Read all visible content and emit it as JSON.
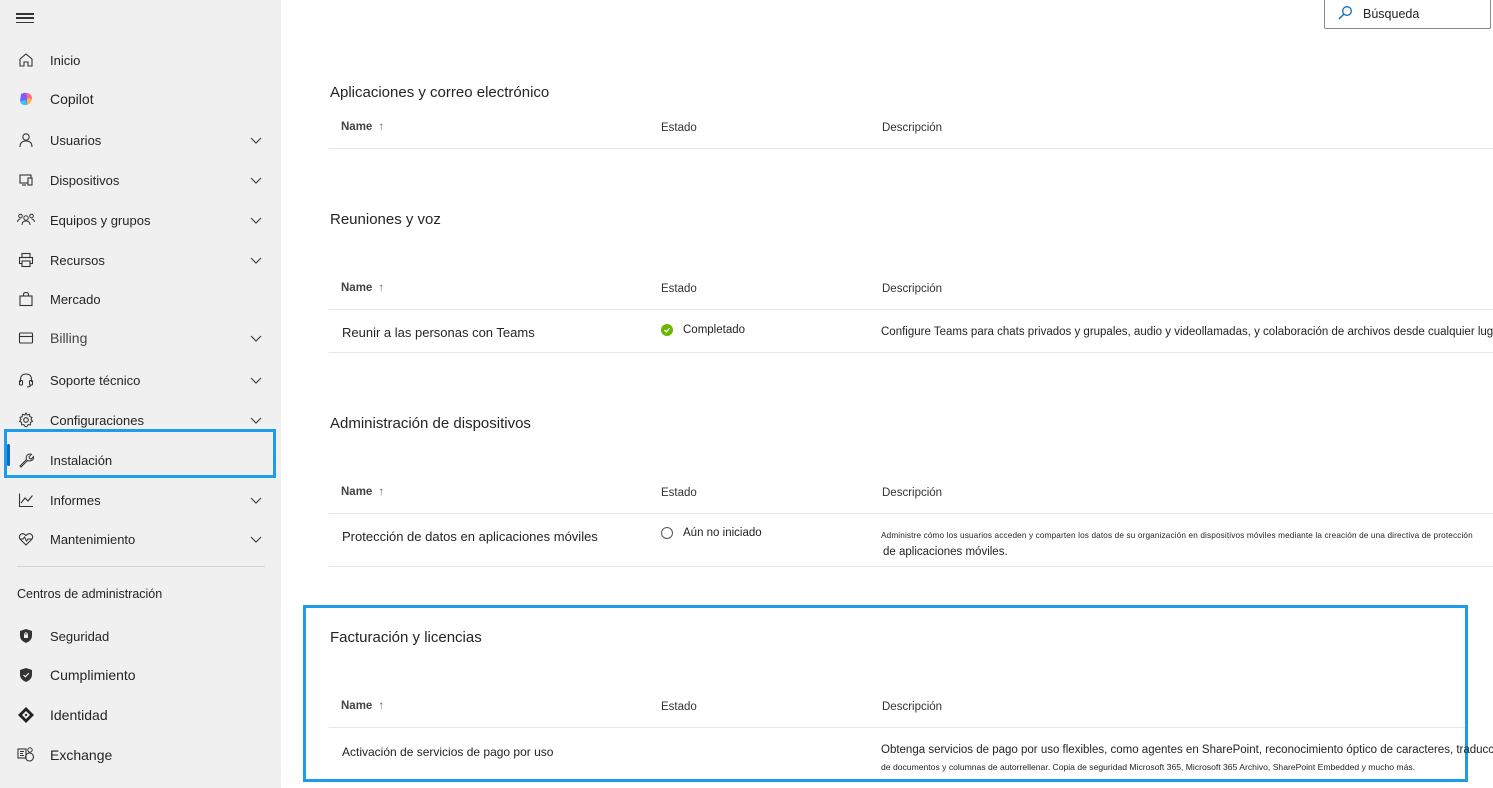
{
  "search": {
    "placeholder": "Búsqueda"
  },
  "sidebar": {
    "items": [
      {
        "label": "Inicio",
        "icon": "home-icon"
      },
      {
        "label": "Copilot",
        "icon": "copilot-icon"
      },
      {
        "label": "Usuarios",
        "icon": "person-icon"
      },
      {
        "label": "Dispositivos",
        "icon": "device-icon"
      },
      {
        "label": "Equipos y grupos",
        "icon": "people-team-icon"
      },
      {
        "label": "Recursos",
        "icon": "printer-icon"
      },
      {
        "label": "Mercado",
        "icon": "shopping-bag-icon"
      },
      {
        "label": "Billing",
        "icon": "credit-card-icon"
      },
      {
        "label": "Soporte técnico",
        "icon": "headset-icon"
      },
      {
        "label": "Configuraciones",
        "icon": "gear-icon"
      },
      {
        "label": "Instalación",
        "icon": "wrench-icon"
      },
      {
        "label": "Informes",
        "icon": "chart-line-icon"
      },
      {
        "label": "Mantenimiento",
        "icon": "heart-pulse-icon"
      }
    ],
    "admin_centers_title": "Centros de administración",
    "admin_centers": [
      {
        "label": "Seguridad",
        "icon": "shield-icon"
      },
      {
        "label": "Cumplimiento",
        "icon": "shield-compliance-icon"
      },
      {
        "label": "Identidad",
        "icon": "identity-diamond-icon"
      },
      {
        "label": "Exchange",
        "icon": "exchange-icon"
      }
    ]
  },
  "table_headers": {
    "name": "Name",
    "estado": "Estado",
    "descripcion": "Descripción",
    "sort_arrow": "↑"
  },
  "sections": [
    {
      "title": "Aplicaciones y correo electrónico",
      "rows": []
    },
    {
      "title": "Reuniones y voz",
      "rows": [
        {
          "name": "Reunir a las personas con Teams",
          "status": "Completado",
          "description": "Configure Teams para chats privados y grupales, audio y videollamadas, y colaboración de archivos desde cualquier lugar."
        }
      ]
    },
    {
      "title": "Administración de dispositivos",
      "rows": [
        {
          "name": "Protección de datos en aplicaciones móviles",
          "status": "Aún no iniciado",
          "description_line1": "Administre cómo los usuarios acceden y comparten los datos de su organización en dispositivos móviles mediante la creación de una directiva de protección",
          "description_line2": "de aplicaciones móviles."
        }
      ]
    },
    {
      "title": "Facturación y licencias",
      "rows": [
        {
          "name": "Activación de servicios de pago por uso",
          "status": "",
          "description_line1": "Obtenga servicios de pago por uso flexibles, como agentes en SharePoint, reconocimiento óptico de caracteres, traducción",
          "description_line2": "de documentos y columnas de autorrellenar. Copia de seguridad Microsoft 365, Microsoft 365 Archivo, SharePoint Embedded y mucho más."
        }
      ]
    }
  ],
  "colors": {
    "accent": "#1e9be9",
    "active": "#0f6cbd",
    "completed": "#6bb700",
    "sidebar_bg": "#f0f0f0"
  }
}
